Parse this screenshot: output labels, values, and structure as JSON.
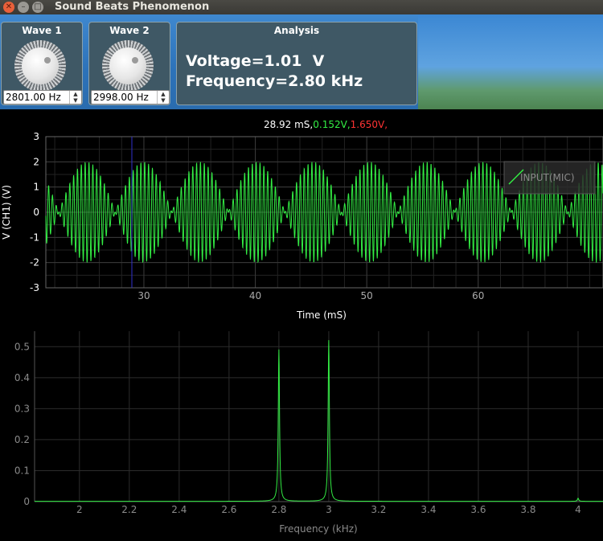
{
  "window": {
    "title": "Sound Beats Phenomenon",
    "close_glyph": "✕",
    "min_glyph": "–",
    "max_glyph": "□"
  },
  "wave1": {
    "label": "Wave 1",
    "frequency": "2801.00 Hz"
  },
  "wave2": {
    "label": "Wave 2",
    "frequency": "2998.00 Hz"
  },
  "analysis": {
    "label": "Analysis",
    "voltage": "Voltage=1.01  V",
    "frequency": "Frequency=2.80 kHz"
  },
  "colors": {
    "trace": "#33ee44",
    "cursor": "#3030cc",
    "toolbar": "#3f88cf",
    "panel": "#3f5865"
  },
  "icons": {
    "spin-up": "▲",
    "spin-down": "▼"
  },
  "scope": {
    "readout_time": "28.92 mS,",
    "readout_ch1": "0.152V,",
    "readout_ch2": "1.650V,",
    "readout_ch1_color": "#33ee44",
    "readout_ch2_color": "#ff3333",
    "legend": "INPUT(MIC)",
    "cursor_time_ms": 28.92
  },
  "chart_data": [
    {
      "type": "line",
      "xlabel": "Time (mS)",
      "ylabel": "V (CH1) (V)",
      "xlim": [
        21.2,
        71.2
      ],
      "ylim": [
        -3,
        3
      ],
      "xticks": [
        30,
        40,
        50,
        60
      ],
      "yticks": [
        -3,
        -2,
        -1,
        0,
        1,
        2,
        3
      ],
      "grid": true,
      "legend_position": "top-right",
      "series": [
        {
          "name": "INPUT(MIC)",
          "f1_khz": 2.801,
          "f2_khz": 2.998,
          "amplitude_each": 1.0
        }
      ]
    },
    {
      "type": "line",
      "xlabel": "Frequency (kHz)",
      "ylabel": "",
      "xlim": [
        1.82,
        4.1
      ],
      "ylim": [
        0,
        0.55
      ],
      "xticks": [
        2,
        2.2,
        2.4,
        2.6,
        2.8,
        3,
        3.2,
        3.4,
        3.6,
        3.8,
        4
      ],
      "yticks": [
        0,
        0.1,
        0.2,
        0.3,
        0.4,
        0.5
      ],
      "grid": true,
      "series": [
        {
          "peaks": [
            {
              "x": 2.8,
              "y": 0.49
            },
            {
              "x": 3.0,
              "y": 0.52
            },
            {
              "x": 4.0,
              "y": 0.01
            }
          ]
        }
      ]
    }
  ]
}
